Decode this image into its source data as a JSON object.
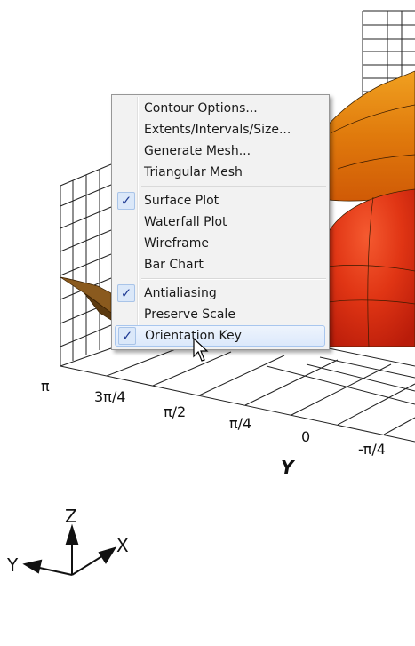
{
  "plot": {
    "axis_title_y": "Y",
    "y_ticks": [
      "π",
      "3π/4",
      "π/2",
      "π/4",
      "0",
      "-π/4"
    ],
    "surface_colors": [
      "#d6c500",
      "#e88f00",
      "#e23a14"
    ]
  },
  "orientation_key": {
    "z": "Z",
    "y": "Y",
    "x": "X"
  },
  "context_menu": {
    "items": [
      {
        "label": "Contour Options...",
        "checked": false
      },
      {
        "label": "Extents/Intervals/Size...",
        "checked": false
      },
      {
        "label": "Generate Mesh...",
        "checked": false
      },
      {
        "label": "Triangular Mesh",
        "checked": false
      },
      {
        "label": "Surface Plot",
        "checked": true
      },
      {
        "label": "Waterfall Plot",
        "checked": false
      },
      {
        "label": "Wireframe",
        "checked": false
      },
      {
        "label": "Bar Chart",
        "checked": false
      },
      {
        "label": "Antialiasing",
        "checked": true
      },
      {
        "label": "Preserve Scale",
        "checked": false
      },
      {
        "label": "Orientation Key",
        "checked": true,
        "highlighted": true
      }
    ],
    "checkmark": "✓"
  }
}
